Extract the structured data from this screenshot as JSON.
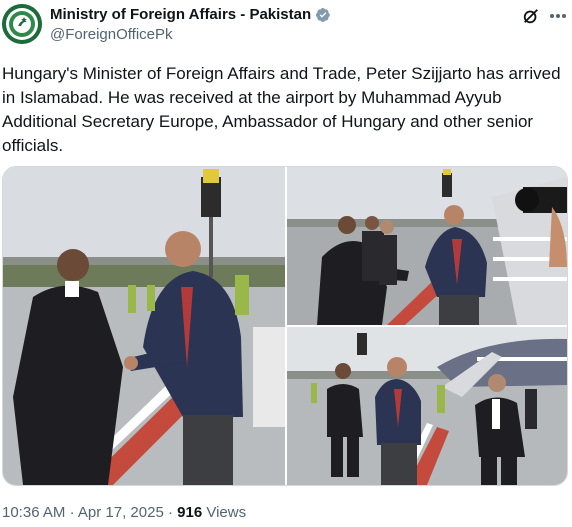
{
  "tweet": {
    "account_name": "Ministry of Foreign Affairs - Pakistan",
    "handle": "@ForeignOfficePk",
    "text": "Hungary's Minister of Foreign Affairs and Trade, Peter Szijjarto  has arrived in Islamabad. He was received at the airport by Muhammad Ayyub Additional Secretary Europe, Ambassador of Hungary and other senior officials.",
    "time": "10:36 AM",
    "separator": "·",
    "date": "Apr 17, 2025",
    "views_count": "916",
    "views_label": "Views"
  },
  "icons": {
    "avatar": "mofa-pakistan-logo",
    "verified": "verified-badge-icon",
    "grok": "grok-icon",
    "more": "more-icon"
  },
  "colors": {
    "text_primary": "#0f1419",
    "text_secondary": "#536471",
    "border": "#cfd9de",
    "verified_grey": "#829aab",
    "logo_green": "#1d6b3a"
  }
}
